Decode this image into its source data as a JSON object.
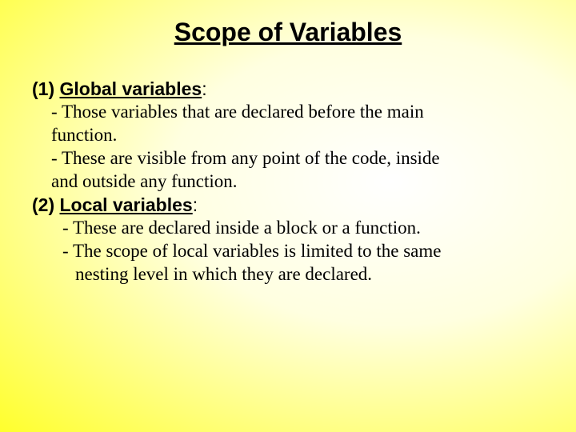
{
  "title": "Scope of Variables",
  "section1": {
    "num": "(1) ",
    "heading": "Global variables",
    "colon": ":",
    "point1a": "- Those variables that are declared before the main",
    "point1b": "function.",
    "point2a": "- These are visible from any point of the code, inside",
    "point2b": "and outside any function."
  },
  "section2": {
    "num": "(2) ",
    "heading": "Local variables",
    "colon": ":",
    "point1": "- These are declared inside a block or a function.",
    "point2a": "- The scope of local variables is limited to the same",
    "point2b": "nesting level in which they are declared."
  }
}
